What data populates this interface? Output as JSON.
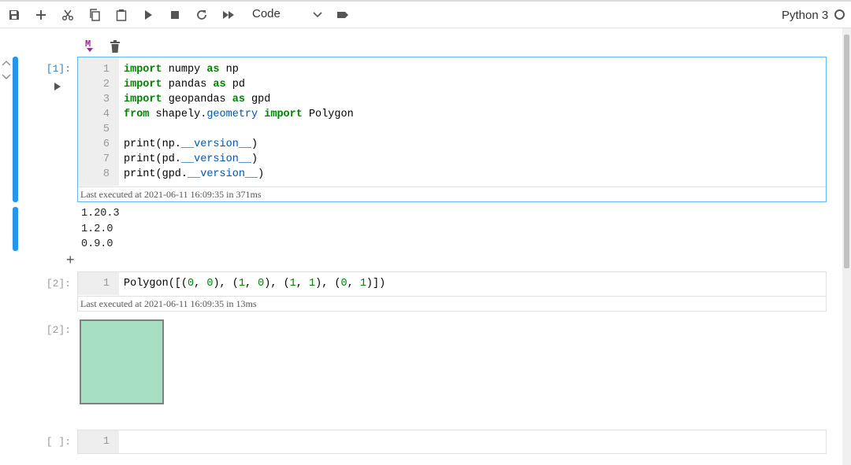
{
  "toolbar": {
    "icons": [
      "save-icon",
      "add-cell-icon",
      "cut-icon",
      "copy-icon",
      "paste-icon",
      "run-icon",
      "stop-icon",
      "restart-icon",
      "fast-forward-icon",
      "tag-icon"
    ],
    "cell_type": "Code",
    "kernel_name": "Python 3"
  },
  "cell_toolbar": {
    "markdown_label": "M"
  },
  "cells": [
    {
      "prompt": "[1]:",
      "line_numbers": [
        "1",
        "2",
        "3",
        "4",
        "5",
        "6",
        "7",
        "8"
      ],
      "exec_info": "Last executed at 2021-06-11 16:09:35 in 371ms",
      "output_lines": [
        "1.20.3",
        "1.2.0",
        "0.9.0"
      ],
      "code_parts": {
        "l1": [
          "import",
          " numpy ",
          "as",
          " np"
        ],
        "l2": [
          "import",
          " pandas ",
          "as",
          " pd"
        ],
        "l3": [
          "import",
          " geopandas ",
          "as",
          " gpd"
        ],
        "l4": [
          "from",
          " shapely.",
          "geometry",
          " ",
          "import",
          " Polygon"
        ],
        "l6": [
          "print(np.",
          "__version__",
          ")"
        ],
        "l7": [
          "print(pd.",
          "__version__",
          ")"
        ],
        "l8": [
          "print(gpd.",
          "__version__",
          ")"
        ]
      }
    },
    {
      "prompt": "[2]:",
      "line_numbers": [
        "1"
      ],
      "code_parts": [
        "Polygon([(",
        "0",
        ", ",
        "0",
        "), (",
        "1",
        ", ",
        "0",
        "), (",
        "1",
        ", ",
        "1",
        "), (",
        "0",
        ", ",
        "1",
        ")])"
      ],
      "exec_info": "Last executed at 2021-06-11 16:09:35 in 13ms",
      "output_prompt": "[2]:",
      "output_fill": "#a6dfc2",
      "output_stroke": "#808080"
    },
    {
      "prompt": "[ ]:",
      "line_numbers": [
        "1"
      ]
    }
  ],
  "add_cell_label": "+"
}
